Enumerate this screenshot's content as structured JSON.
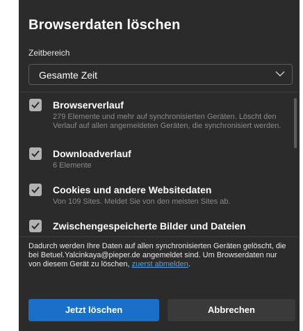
{
  "dialog": {
    "title": "Browserdaten löschen",
    "close_icon": "×"
  },
  "time_range": {
    "label": "Zeitbereich",
    "selected": "Gesamte Zeit"
  },
  "items": [
    {
      "title": "Browserverlauf",
      "description": "279 Elemente und mehr auf synchronisierten Geräten. Löscht den Verlauf auf allen angemeldeten Geräten, die synchronisiert werden.",
      "checked": true
    },
    {
      "title": "Downloadverlauf",
      "description": "6 Elemente",
      "checked": true
    },
    {
      "title": "Cookies und andere Websitedaten",
      "description": "Von 109 Sites. Meldet Sie von den meisten Sites ab.",
      "checked": true
    },
    {
      "title": "Zwischengespeicherte Bilder und Dateien",
      "description": "",
      "checked": true
    }
  ],
  "notice": {
    "text": "Dadurch werden Ihre Daten auf allen synchronisierten Geräten gelöscht, die bei Betuel.Yalcinkaya@pieper.de angemeldet sind. Um Browserdaten nur von diesem Gerät zu löschen,",
    "link_text": "zuerst abmelden",
    "suffix": "."
  },
  "buttons": {
    "primary": "Jetzt löschen",
    "secondary": "Abbrechen"
  },
  "colors": {
    "dialog_bg": "#2b2b2b",
    "primary_button": "#1a6fc8",
    "link": "#4ea4ef",
    "checkbox": "#b3b3b3"
  }
}
